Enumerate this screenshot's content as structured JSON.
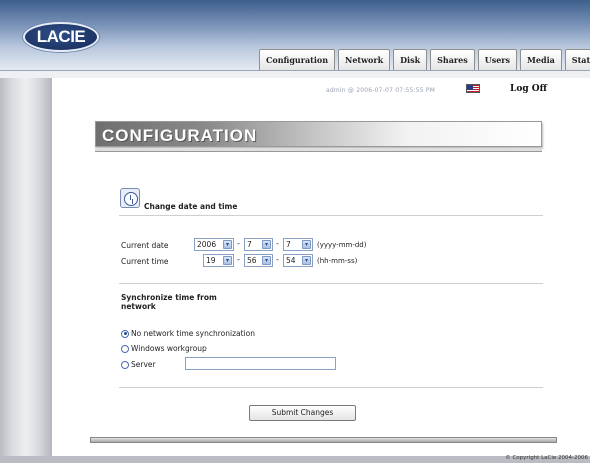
{
  "brand": {
    "logo_text": "LACIE"
  },
  "tabs": [
    {
      "label": "Configuration"
    },
    {
      "label": "Network"
    },
    {
      "label": "Disk"
    },
    {
      "label": "Shares"
    },
    {
      "label": "Users"
    },
    {
      "label": "Media"
    },
    {
      "label": "Status"
    }
  ],
  "status": {
    "session_text": "admin @ 2006-07-07 07:55:55 PM",
    "logoff_label": "Log Off"
  },
  "page": {
    "title": "CONFIGURATION"
  },
  "datetime_section": {
    "heading": "Change date and time",
    "date_label": "Current date",
    "time_label": "Current time",
    "date": {
      "year": "2006",
      "month": "7",
      "day": "7",
      "separator": "-",
      "format": "(yyyy-mm-dd)"
    },
    "time": {
      "hour": "19",
      "minute": "56",
      "second": "54",
      "separator": "-",
      "format": "(hh-mm-ss)"
    }
  },
  "sync_section": {
    "heading": "Synchronize time from network",
    "options": [
      {
        "label": "No network time synchronization",
        "selected": true
      },
      {
        "label": "Windows workgroup",
        "selected": false
      },
      {
        "label": "Server",
        "selected": false
      }
    ],
    "server_value": ""
  },
  "submit_label": "Submit Changes",
  "footer": {
    "copyright": "© Copyright LaCie 2004-2006"
  }
}
